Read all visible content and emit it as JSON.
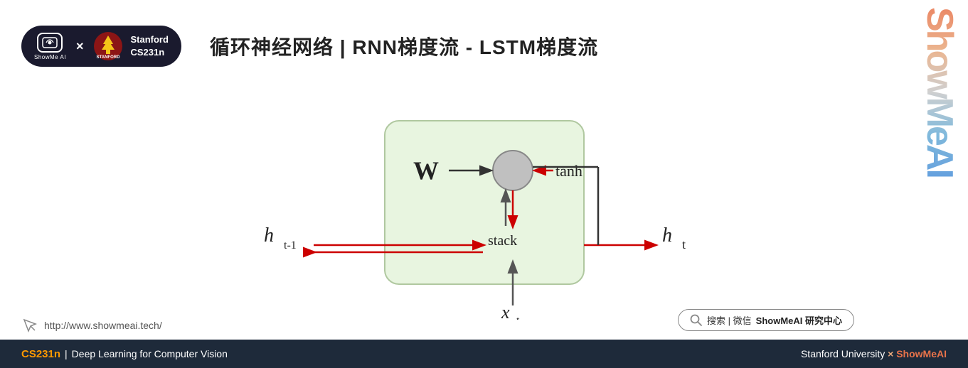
{
  "header": {
    "logo_text": "ShowMe AI",
    "logo_icon_symbol": "⊙",
    "x_separator": "×",
    "stanford_label_line1": "Stanford",
    "stanford_label_line2": "CS231n",
    "main_title": "循环神经网络 | RNN梯度流 - LSTM梯度流"
  },
  "watermark": {
    "text": "ShowMeAI"
  },
  "diagram": {
    "node_W": "W",
    "node_tanh": "tanh",
    "node_stack": "stack",
    "node_ht_minus1": "h",
    "node_ht_minus1_sub": "t-1",
    "node_ht": "h",
    "node_ht_sub": "t",
    "node_xt": "x",
    "node_xt_sub": "t"
  },
  "website": {
    "icon": "↗",
    "url": "http://www.showmeai.tech/"
  },
  "search": {
    "icon": "🔍",
    "text": "搜索 | 微信",
    "brand": "ShowMeAI 研究中心"
  },
  "footer": {
    "cs231n": "CS231n",
    "separator": "|",
    "course_title": " Deep Learning for Computer Vision",
    "right_text": "Stanford University × ShowMeAI"
  }
}
